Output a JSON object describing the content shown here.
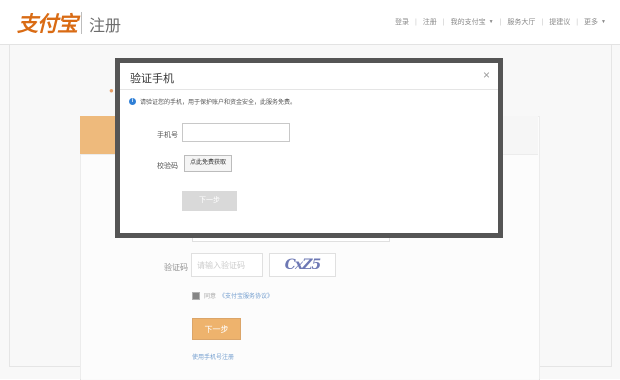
{
  "header": {
    "logo_text": "支付宝",
    "page_name": "注册",
    "nav": [
      {
        "label": "登录",
        "dropdown": false
      },
      {
        "label": "注册",
        "dropdown": false
      },
      {
        "label": "我的支付宝",
        "dropdown": true
      },
      {
        "label": "服务大厅",
        "dropdown": false
      },
      {
        "label": "提建议",
        "dropdown": false
      },
      {
        "label": "更多",
        "dropdown": true
      }
    ]
  },
  "background_form": {
    "captcha_label": "验证码",
    "captcha_placeholder": "请输入验证码",
    "captcha_image_text": "CxZ5",
    "agree_text": "同意",
    "agree_link": "《支付宝服务协议》",
    "next_button": "下一步",
    "alt_link": "使用手机号注册"
  },
  "modal": {
    "title": "验证手机",
    "close_symbol": "×",
    "tip": "请验证您的手机，用于保护账户和资金安全，此服务免费。",
    "phone_label": "手机号",
    "code_label": "校验码",
    "get_code_button": "点此免费获取",
    "next_button": "下一步"
  },
  "colors": {
    "brand_orange": "#e58a1f",
    "link_blue": "#2a6bb5",
    "modal_border": "#555555",
    "info_blue": "#2f7fd6"
  },
  "icons": {
    "info": "info-icon",
    "close": "close-icon",
    "caret": "chevron-down-icon"
  }
}
